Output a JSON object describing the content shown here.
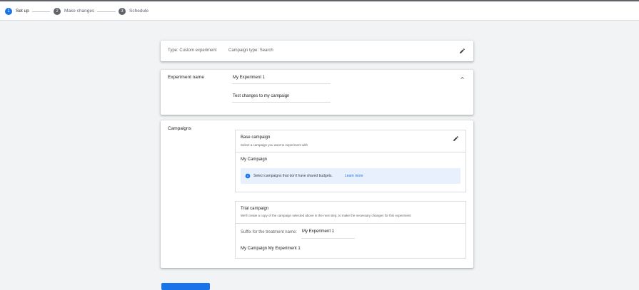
{
  "stepper": {
    "steps": [
      {
        "number": "1",
        "label": "Set up"
      },
      {
        "number": "2",
        "label": "Make changes"
      },
      {
        "number": "3",
        "label": "Schedule"
      }
    ]
  },
  "type_card": {
    "type_text": "Type: Custom experiment",
    "campaign_type_text": "Campaign type: Search"
  },
  "experiment_card": {
    "label": "Experiment name",
    "name_value": "My Experiment 1",
    "description_value": "Test changes to my campaign"
  },
  "campaigns_card": {
    "label": "Campaigns",
    "base": {
      "title": "Base campaign",
      "subtitle": "Select a campaign you want to experiment with",
      "selected": "My Campaign",
      "info_text": "Select campaigns that don't have shared budgets.",
      "info_link": "Learn more"
    },
    "trial": {
      "title": "Trial campaign",
      "subtitle": "We'll create a copy of the campaign selected above in the next step, to make the necessary changes for this experiment",
      "suffix_label": "Suffix for the treatment name:",
      "suffix_value": "My Experiment 1",
      "result_name": "My Campaign My Experiment 1"
    }
  },
  "colors": {
    "accent": "#1a73e8",
    "info_bg": "#e8f0fe",
    "background": "#f1f3f4"
  },
  "icons": [
    "pencil-icon",
    "chevron-up-icon",
    "info-icon"
  ]
}
